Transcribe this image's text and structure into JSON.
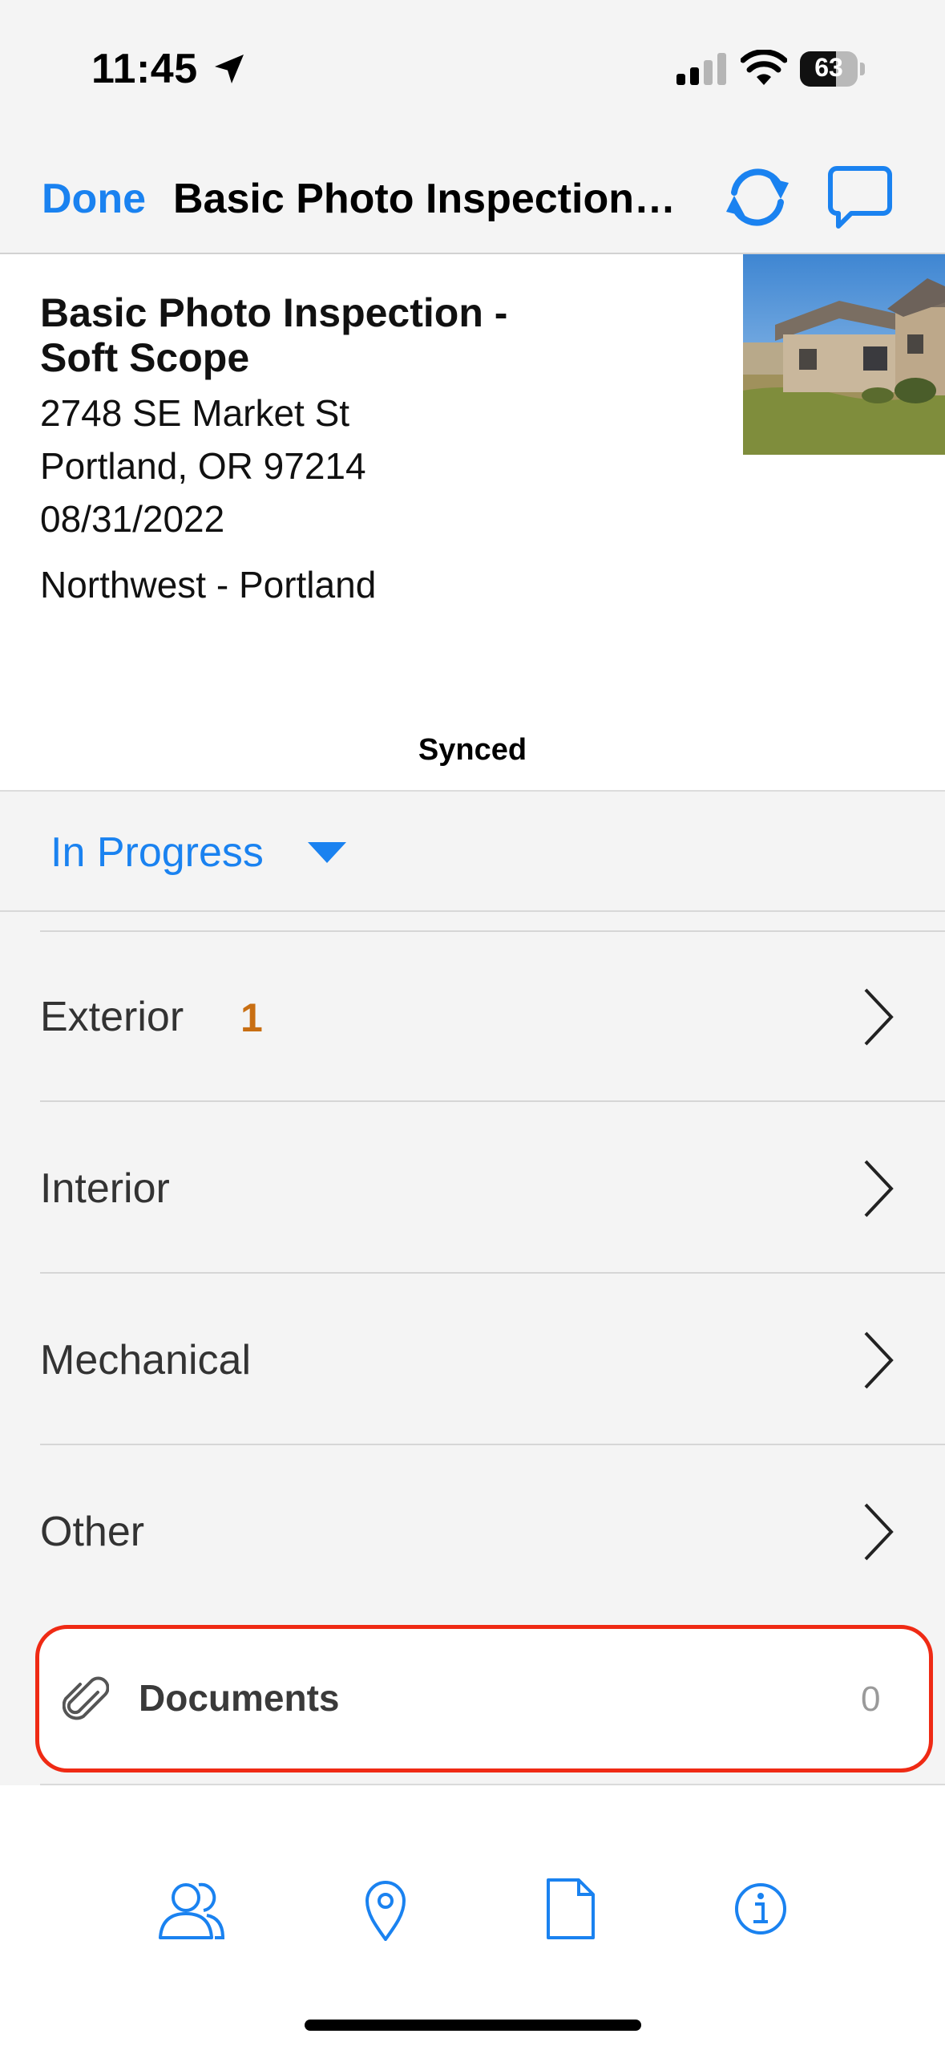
{
  "status_bar": {
    "time": "11:45",
    "battery_percent": 63,
    "battery_text": "63"
  },
  "nav": {
    "done_label": "Done",
    "title": "Basic Photo Inspection…"
  },
  "inspection": {
    "title": "Basic Photo Inspection - Soft Scope",
    "address_line1": "2748 SE Market St",
    "address_line2": "Portland, OR 97214",
    "date": "08/31/2022",
    "region": "Northwest - Portland",
    "sync_status": "Synced"
  },
  "status_dropdown": {
    "value": "In Progress"
  },
  "sections": [
    {
      "label": "Exterior",
      "count": "1"
    },
    {
      "label": "Interior",
      "count": ""
    },
    {
      "label": "Mechanical",
      "count": ""
    },
    {
      "label": "Other",
      "count": ""
    }
  ],
  "documents": {
    "label": "Documents",
    "count": "0"
  },
  "tabs": [
    {
      "icon": "contacts-icon"
    },
    {
      "icon": "location-pin-icon"
    },
    {
      "icon": "document-icon"
    },
    {
      "icon": "info-icon"
    }
  ],
  "colors": {
    "accent": "#1a82f0",
    "count_orange": "#c86e12",
    "highlight_red": "#ef2a14"
  }
}
